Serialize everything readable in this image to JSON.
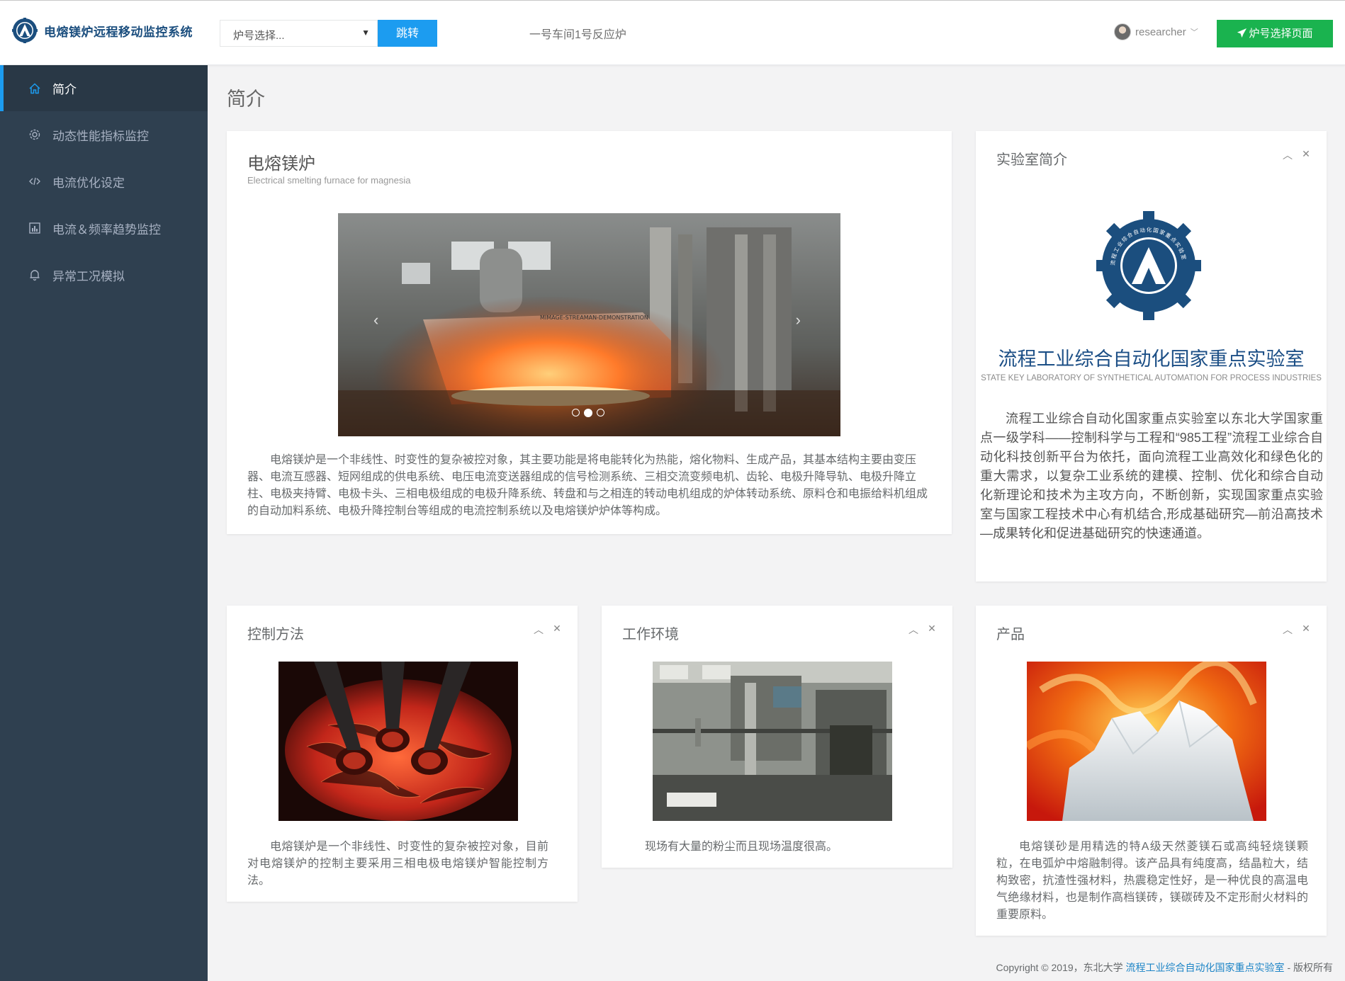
{
  "app": {
    "title": "电熔镁炉远程移动监控系统"
  },
  "topbar": {
    "furnace_select_placeholder": "炉号选择...",
    "jump_label": "跳转",
    "location": "一号车间1号反应炉",
    "username": "researcher",
    "select_page_label": "炉号选择页面"
  },
  "sidebar": {
    "items": [
      {
        "label": "简介",
        "icon": "home-icon",
        "active": true
      },
      {
        "label": "动态性能指标监控",
        "icon": "gear-icon",
        "active": false
      },
      {
        "label": "电流优化设定",
        "icon": "code-icon",
        "active": false
      },
      {
        "label": "电流＆频率趋势监控",
        "icon": "bar-chart-icon",
        "active": false
      },
      {
        "label": "异常工况模拟",
        "icon": "bell-icon",
        "active": false
      }
    ]
  },
  "page": {
    "heading": "简介"
  },
  "furnace": {
    "title": "电熔镁炉",
    "subtitle": "Electrical smelting furnace for magnesia",
    "carousel_watermark": "MIMAGE-STREAMAN-DEMONSTRATION",
    "description": "电熔镁炉是一个非线性、时变性的复杂被控对象，其主要功能是将电能转化为热能，熔化物料、生成产品，其基本结构主要由变压器、电流互感器、短网组成的供电系统、电压电流变送器组成的信号检测系统、三相交流变频电机、齿轮、电极升降导轨、电极升降立柱、电极夹持臂、电极卡头、三相电极组成的电极升降系统、转盘和与之相连的转动电机组成的炉体转动系统、原料仓和电振给料机组成的自动加料系统、电极升降控制台等组成的电流控制系统以及电熔镁炉炉体等构成。"
  },
  "lab": {
    "panel_title": "实验室简介",
    "name": "流程工业综合自动化国家重点实验室",
    "name_en": "STATE KEY LABORATORY OF SYNTHETICAL AUTOMATION FOR PROCESS INDUSTRIES",
    "logo_ring_text": "流程工业综合自动化国家重点实验室",
    "description": "流程工业综合自动化国家重点实验室以东北大学国家重点一级学科——控制科学与工程和“985工程”流程工业综合自动化科技创新平台为依托，面向流程工业高效化和绿色化的重大需求，以复杂工业系统的建模、控制、优化和综合自动化新理论和技术为主攻方向，不断创新，实现国家重点实验室与国家工程技术中心有机结合,形成基础研究—前沿高技术—成果转化和促进基础研究的快速通道。"
  },
  "cards": {
    "control": {
      "title": "控制方法",
      "description": "电熔镁炉是一个非线性、时变性的复杂被控对象，目前对电熔镁炉的控制主要采用三相电极电熔镁炉智能控制方法。"
    },
    "environment": {
      "title": "工作环境",
      "description": "现场有大量的粉尘而且现场温度很高。"
    },
    "product": {
      "title": "产品",
      "description": "电熔镁砂是用精选的特A级天然菱镁石或高纯轻烧镁颗粒，在电弧炉中熔融制得。该产品具有纯度高，结晶粒大，结构致密，抗渣性强材料，热震稳定性好，是一种优良的高温电气绝缘材料，也是制作高档镁砖，镁碳砖及不定形耐火材料的重要原料。"
    }
  },
  "panel_tools": {
    "collapse_icon": "chevron-up-icon",
    "close_icon": "close-icon"
  },
  "footer": {
    "prefix": "Copyright © 2019，东北大学",
    "link": "流程工业综合自动化国家重点实验室",
    "suffix": "- 版权所有"
  },
  "colors": {
    "sidebar_bg": "#2f4050",
    "accent_blue": "#1c9cf0",
    "success_green": "#1ab34f",
    "brand_navy": "#1b4e7e"
  }
}
